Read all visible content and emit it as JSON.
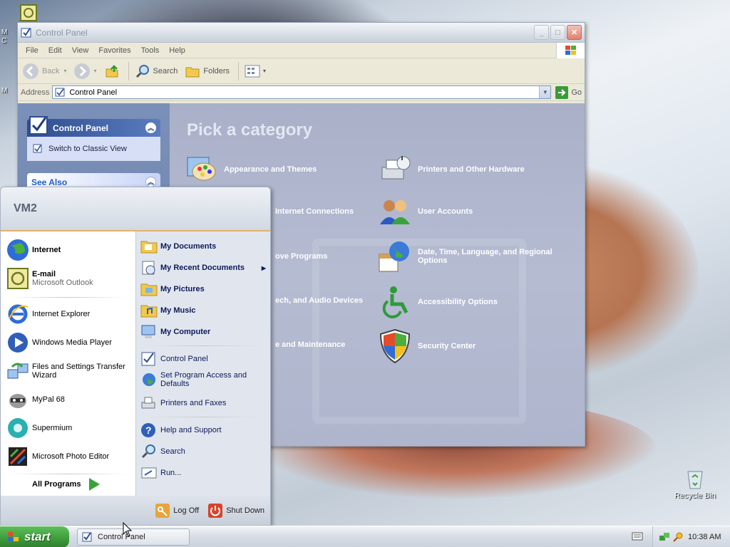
{
  "desktop": {
    "recycle_bin_label": "Recycle Bin",
    "left_edge_labels": [
      "M",
      "C",
      "M"
    ]
  },
  "window": {
    "title": "Control Panel",
    "menu": [
      "File",
      "Edit",
      "View",
      "Favorites",
      "Tools",
      "Help"
    ],
    "toolbar": {
      "back": "Back",
      "search": "Search",
      "folders": "Folders"
    },
    "address": {
      "label": "Address",
      "value": "Control Panel",
      "go": "Go"
    },
    "sidebar": {
      "panel_title": "Control Panel",
      "switch_view": "Switch to Classic View",
      "see_also": "See Also"
    },
    "main": {
      "heading": "Pick a category",
      "categories_left": [
        "Appearance and Themes",
        "Internet Connections",
        "ove Programs",
        "ech, and Audio Devices",
        "e and Maintenance"
      ],
      "categories_right": [
        "Printers and Other Hardware",
        "User Accounts",
        "Date, Time, Language, and Regional Options",
        "Accessibility Options",
        "Security Center"
      ]
    }
  },
  "start_menu": {
    "user": "VM2",
    "pinned": [
      {
        "label": "Internet",
        "sub": ""
      },
      {
        "label": "E-mail",
        "sub": "Microsoft Outlook"
      }
    ],
    "recent": [
      "Internet Explorer",
      "Windows Media Player",
      "Files and Settings Transfer Wizard",
      "MyPal 68",
      "Supermium",
      "Microsoft Photo Editor"
    ],
    "all_programs": "All Programs",
    "places": [
      "My Documents",
      "My Recent Documents",
      "My Pictures",
      "My Music",
      "My Computer"
    ],
    "settings": [
      "Control Panel",
      "Set Program Access and Defaults",
      "Printers and Faxes"
    ],
    "tools": [
      "Help and Support",
      "Search",
      "Run..."
    ],
    "log_off": "Log Off",
    "shut_down": "Shut Down"
  },
  "taskbar": {
    "start": "start",
    "task_label": "Control Panel",
    "clock": "10:38 AM"
  },
  "colors": {
    "accent": "#215dc6",
    "start_green": "#3c9b3a",
    "sidebar_blue": "#6b7fa6"
  }
}
